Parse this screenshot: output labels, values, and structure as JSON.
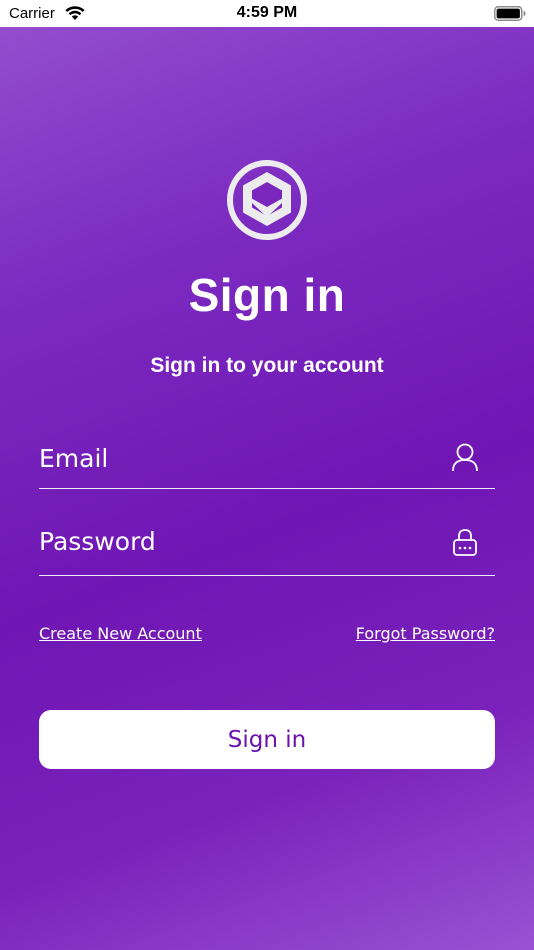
{
  "status_bar": {
    "carrier": "Carrier",
    "time": "4:59 PM"
  },
  "header": {
    "title": "Sign in",
    "subtitle": "Sign in to your account"
  },
  "form": {
    "email_placeholder": "Email",
    "password_placeholder": "Password",
    "email_icon": "user-icon",
    "password_icon": "lock-icon"
  },
  "links": {
    "create_account": "Create New Account",
    "forgot_password": "Forgot Password?"
  },
  "actions": {
    "signin_label": "Sign in"
  },
  "colors": {
    "gradient_primary": "#6f16b4",
    "gradient_light": "#9550cf",
    "button_text": "#6a14ad",
    "text": "#ffffff"
  }
}
